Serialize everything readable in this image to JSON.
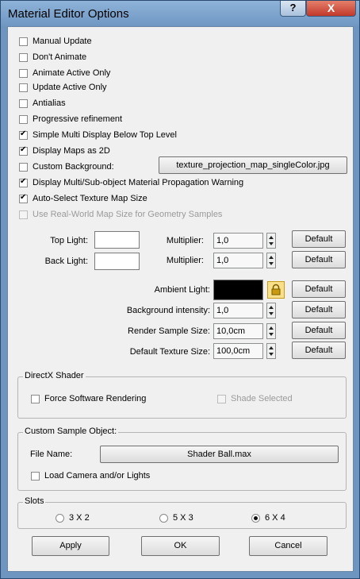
{
  "window": {
    "title": "Material Editor Options",
    "help_label": "?",
    "close_label": "X"
  },
  "options": [
    {
      "label": "Manual Update",
      "checked": false,
      "disabled": false
    },
    {
      "label": "Don't Animate",
      "checked": false,
      "disabled": false
    },
    {
      "label": "Animate Active Only",
      "checked": false,
      "disabled": false
    },
    {
      "label": "Update Active Only",
      "checked": false,
      "disabled": false
    },
    {
      "label": "Antialias",
      "checked": false,
      "disabled": false
    },
    {
      "label": "Progressive refinement",
      "checked": false,
      "disabled": false
    },
    {
      "label": "Simple Multi Display Below Top Level",
      "checked": true,
      "disabled": false
    },
    {
      "label": "Display Maps as 2D",
      "checked": true,
      "disabled": false
    },
    {
      "label": "Custom Background:",
      "checked": false,
      "disabled": false
    },
    {
      "label": "Display Multi/Sub-object Material Propagation Warning",
      "checked": true,
      "disabled": false
    },
    {
      "label": "Auto-Select Texture Map Size",
      "checked": true,
      "disabled": false
    },
    {
      "label": "Use Real-World Map Size for Geometry Samples",
      "checked": false,
      "disabled": true
    }
  ],
  "custom_background_file": "texture_projection_map_singleColor.jpg",
  "lights": {
    "top_light_label": "Top Light:",
    "back_light_label": "Back Light:",
    "top_light_color": "#ffffff",
    "back_light_color": "#ffffff",
    "multiplier_label": "Multiplier:",
    "top_multiplier": "1,0",
    "back_multiplier": "1,0",
    "ambient_label": "Ambient Light:",
    "ambient_color": "#000000",
    "background_intensity_label": "Background intensity:",
    "background_intensity": "1,0",
    "render_sample_size_label": "Render Sample Size:",
    "render_sample_size": "10,0cm",
    "default_texture_size_label": "Default Texture Size:",
    "default_texture_size": "100,0cm"
  },
  "default_label": "Default",
  "directx": {
    "title": "DirectX Shader",
    "force_software": "Force Software Rendering",
    "shade_selected": "Shade Selected"
  },
  "custom_sample": {
    "title": "Custom Sample Object:",
    "file_name_label": "File Name:",
    "file_name": "Shader Ball.max",
    "load_camera": "Load Camera and/or Lights"
  },
  "slots": {
    "title": "Slots",
    "options": [
      "3 X 2",
      "5 X 3",
      "6 X 4"
    ],
    "selected": "6 X 4"
  },
  "buttons": {
    "apply": "Apply",
    "ok": "OK",
    "cancel": "Cancel"
  }
}
